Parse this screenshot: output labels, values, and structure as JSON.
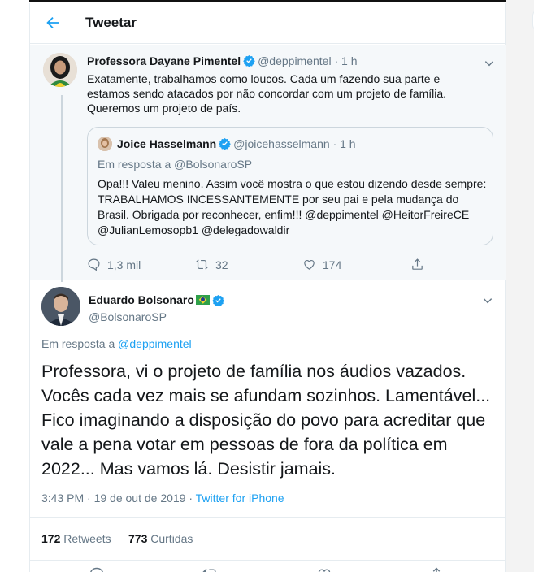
{
  "header": {
    "title": "Tweetar"
  },
  "parent_tweet": {
    "name": "Professora Dayane Pimentel",
    "handle": "@deppimentel",
    "time": "· 1 h",
    "text": "Exatamente, trabalhamos como loucos. Cada um fazendo sua parte e estamos sendo atacados por não concordar com um projeto de família. Queremos um projeto de país.",
    "quote": {
      "name": "Joice Hasselmann",
      "handle": "@joicehasselmann",
      "time": "· 1 h",
      "reply_to": "Em resposta a @BolsonaroSP",
      "text": "Opa!!! Valeu menino. Assim você mostra o que estou dizendo desde sempre: TRABALHAMOS INCESSANTEMENTE por seu pai e pela mudança do Brasil. Obrigada por reconhecer, enfim!!! @deppimentel @HeitorFreireCE @JulianLemosopb1 @delegadowaldir"
    },
    "actions": {
      "replies": "1,3 mil",
      "retweets": "32",
      "likes": "174"
    }
  },
  "main_tweet": {
    "name": "Eduardo Bolsonaro",
    "handle": "@BolsonaroSP",
    "reply_prefix": "Em resposta a",
    "reply_handle": "@deppimentel",
    "text": "Professora, vi o projeto de família nos áudios vazados. Vocês cada vez mais se afundam sozinhos. Lamentável... Fico imaginando a disposição do povo para acreditar que vale a pena votar em pessoas de fora da política em 2022... Mas vamos lá. Desistir jamais.",
    "timestamp": "3:43 PM · 19 de out de 2019 · ",
    "source": "Twitter for iPhone",
    "retweets_count": "172",
    "retweets_label": "Retweets",
    "likes_count": "773",
    "likes_label": "Curtidas"
  },
  "icons": {
    "back": "arrow-left-icon",
    "verified": "verified-badge-icon",
    "chevron": "chevron-down-icon",
    "reply": "reply-icon",
    "retweet": "retweet-icon",
    "like": "heart-icon",
    "share": "share-icon"
  },
  "colors": {
    "accent": "#1da1f2",
    "secondary_text": "#657786",
    "thread_bg": "#f5f8fa"
  }
}
